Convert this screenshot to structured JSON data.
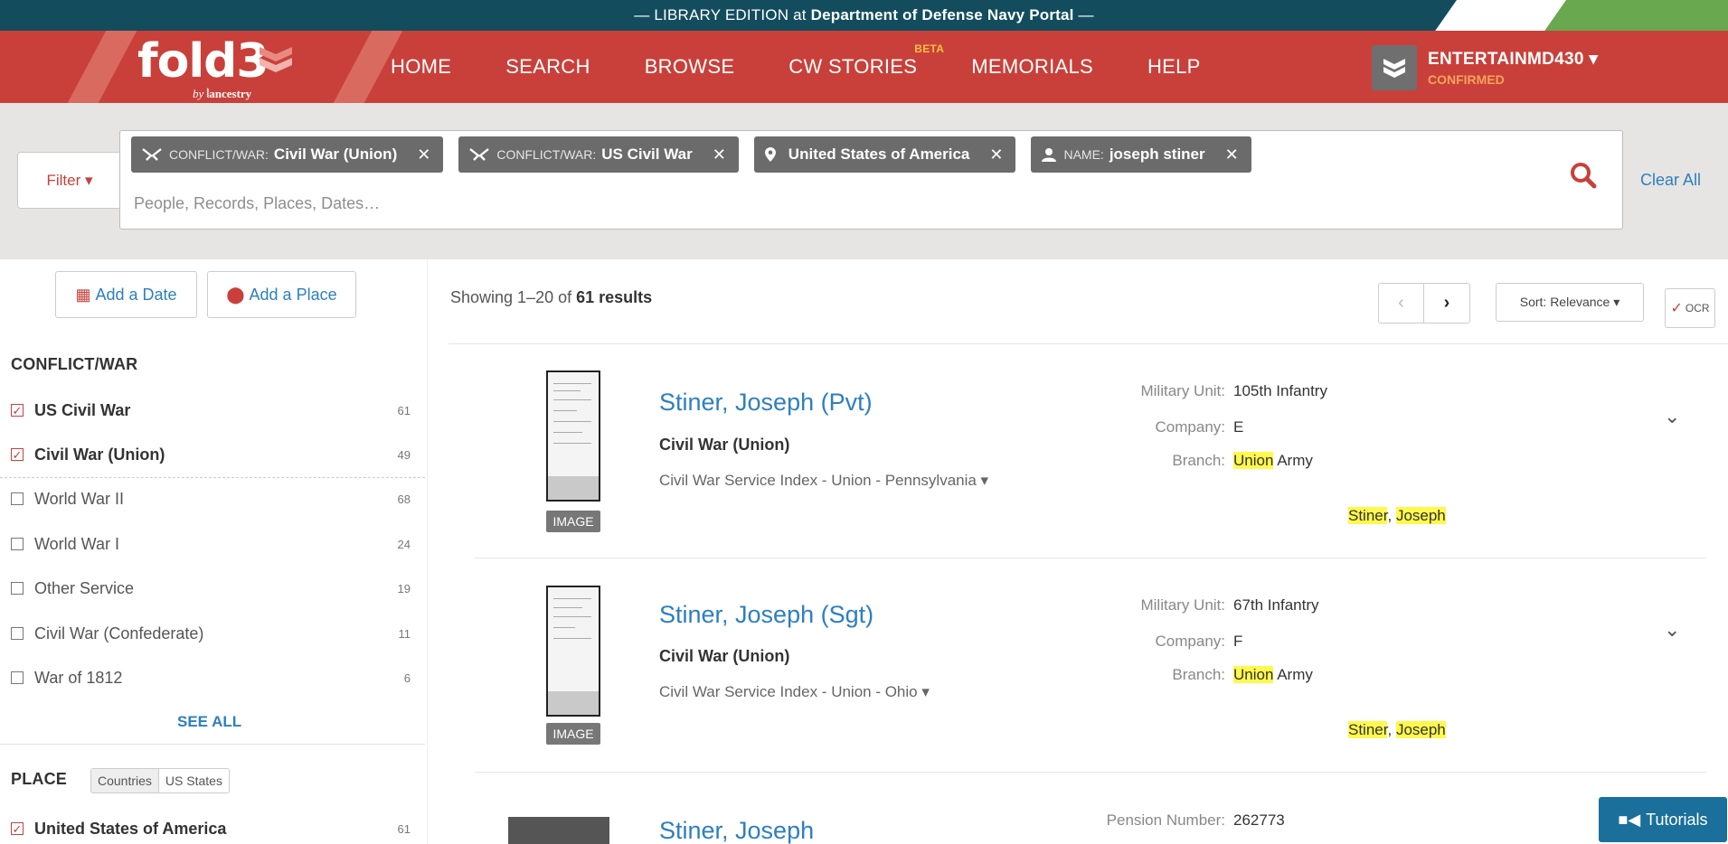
{
  "banner": {
    "prefix": "— LIBRARY EDITION at ",
    "org": "Department of Defense Navy Portal",
    "suffix": " —"
  },
  "logo": {
    "text": "fold3",
    "by": "by",
    "brand": "ancestry"
  },
  "nav": [
    {
      "label": "HOME"
    },
    {
      "label": "SEARCH"
    },
    {
      "label": "BROWSE"
    },
    {
      "label": "CW STORIES",
      "badge": "BETA"
    },
    {
      "label": "MEMORIALS"
    },
    {
      "label": "HELP"
    }
  ],
  "user": {
    "name": "ENTERTAINMD430 ▾",
    "status": "CONFIRMED"
  },
  "filter": {
    "button": "Filter ▾",
    "chips": [
      {
        "key": "CONFLICT/WAR:",
        "value": "Civil War (Union)",
        "icon": "swords-icon"
      },
      {
        "key": "CONFLICT/WAR:",
        "value": "US Civil War",
        "icon": "swords-icon"
      },
      {
        "key": "",
        "value": "United States of America",
        "icon": "map-pin-icon"
      },
      {
        "key": "NAME:",
        "value": "joseph stiner",
        "icon": "person-icon"
      }
    ],
    "placeholder": "People, Records, Places, Dates…",
    "clear_all": "Clear All"
  },
  "sidebar": {
    "add_date": "Add a Date",
    "add_place": "Add a Place",
    "conflict_title": "CONFLICT/WAR",
    "conflicts": [
      {
        "label": "US Civil War",
        "count": "61",
        "checked": true
      },
      {
        "label": "Civil War (Union)",
        "count": "49",
        "checked": true
      },
      {
        "label": "World War II",
        "count": "68",
        "checked": false
      },
      {
        "label": "World War I",
        "count": "24",
        "checked": false
      },
      {
        "label": "Other Service",
        "count": "19",
        "checked": false
      },
      {
        "label": "Civil War (Confederate)",
        "count": "11",
        "checked": false
      },
      {
        "label": "War of 1812",
        "count": "6",
        "checked": false
      }
    ],
    "see_all": "SEE ALL",
    "place_title": "PLACE",
    "place_tabs": [
      "Countries",
      "US States"
    ],
    "places": [
      {
        "label": "United States of America",
        "count": "61",
        "checked": true
      }
    ]
  },
  "results": {
    "showing_prefix": "Showing 1–20 of ",
    "showing_bold": "61 results",
    "sort": "Sort: Relevance ▾",
    "ocr": "OCR",
    "items": [
      {
        "name": "Stiner, Joseph (Pvt)",
        "war": "Civil War (Union)",
        "collection": "Civil War Service Index - Union - Pennsylvania ▾",
        "badge": "IMAGE",
        "meta": [
          {
            "k": "Military Unit:",
            "v": "105th Infantry"
          },
          {
            "k": "Company:",
            "v": "E"
          },
          {
            "k": "Branch:",
            "v_hl": "Union",
            "v": " Army"
          }
        ],
        "highlight": {
          "a": "Stiner",
          "sep": ", ",
          "b": "Joseph"
        }
      },
      {
        "name": "Stiner, Joseph (Sgt)",
        "war": "Civil War (Union)",
        "collection": "Civil War Service Index - Union - Ohio ▾",
        "badge": "IMAGE",
        "meta": [
          {
            "k": "Military Unit:",
            "v": "67th Infantry"
          },
          {
            "k": "Company:",
            "v": "F"
          },
          {
            "k": "Branch:",
            "v_hl": "Union",
            "v": " Army"
          }
        ],
        "highlight": {
          "a": "Stiner",
          "sep": ", ",
          "b": "Joseph"
        }
      },
      {
        "name": "Stiner, Joseph",
        "meta": [
          {
            "k": "Pension Number:",
            "v": "262773"
          }
        ]
      }
    ]
  },
  "tutorials": "Tutorials",
  "colors": {
    "brand_red": "#c9403a",
    "banner": "#134d5d",
    "link": "#2d7fbf",
    "highlight": "#fff84d"
  }
}
